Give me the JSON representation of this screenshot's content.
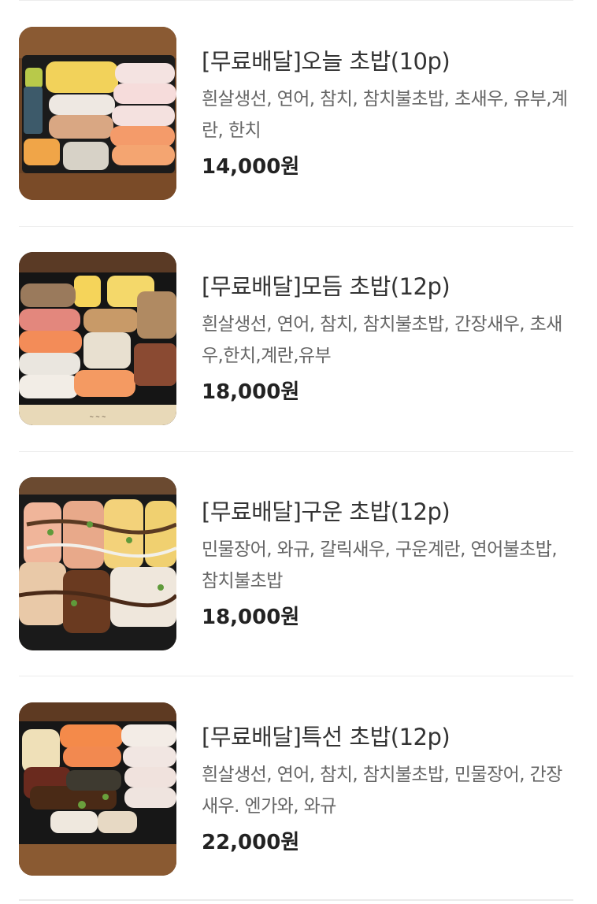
{
  "menu": {
    "items": [
      {
        "name": "[무료배달]오늘 초밥(10p)",
        "description": "흰살생선, 연어, 참치, 참치불초밥, 초새우, 유부,계란, 한치",
        "price": "14,000원"
      },
      {
        "name": "[무료배달]모듬 초밥(12p)",
        "description": "흰살생선, 연어, 참치, 참치불초밥, 간장새우, 초새우,한치,계란,유부",
        "price": "18,000원"
      },
      {
        "name": "[무료배달]구운 초밥(12p)",
        "description": "민물장어, 와규, 갈릭새우, 구운계란, 연어불초밥, 참치불초밥",
        "price": "18,000원"
      },
      {
        "name": "[무료배달]특선 초밥(12p)",
        "description": "흰살생선, 연어, 참치, 참치불초밥, 민물장어, 간장새우. 엔가와, 와규",
        "price": "22,000원"
      }
    ]
  }
}
